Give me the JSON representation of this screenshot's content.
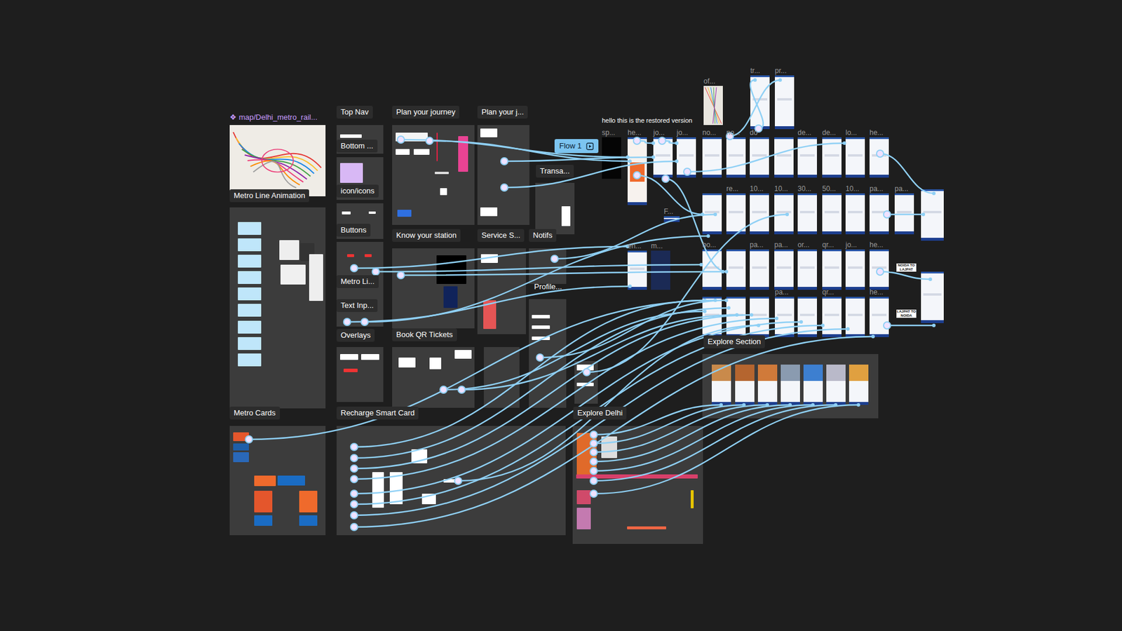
{
  "component": {
    "icon": "❖",
    "label": "map/Delhi_metro_rail..."
  },
  "note": "hello this is the restored version",
  "flow": {
    "label": "Flow 1"
  },
  "sections": [
    {
      "label": "Metro Line Animation",
      "kind": "badge"
    },
    {
      "label": "Metro Cards",
      "kind": "badge"
    },
    {
      "label": "Top Nav",
      "kind": "badge"
    },
    {
      "label": "Bottom ...",
      "kind": "badge"
    },
    {
      "label": "icon/icons",
      "kind": "badge"
    },
    {
      "label": "Buttons",
      "kind": "badge"
    },
    {
      "label": "Metro Li...",
      "kind": "badge"
    },
    {
      "label": "Text Inp...",
      "kind": "badge"
    },
    {
      "label": "Overlays",
      "kind": "badge"
    },
    {
      "label": "Recharge Smart Card",
      "kind": "badge"
    },
    {
      "label": "Plan your journey",
      "kind": "badge"
    },
    {
      "label": "Know your station",
      "kind": "badge"
    },
    {
      "label": "Book QR Tickets",
      "kind": "badge"
    },
    {
      "label": "Plan your j...",
      "kind": "badge"
    },
    {
      "label": "Service S...",
      "kind": "badge"
    },
    {
      "label": "Transa...",
      "kind": "badge"
    },
    {
      "label": "Notifs",
      "kind": "badge"
    },
    {
      "label": "Profile...",
      "kind": "plain"
    },
    {
      "label": "Explore Delhi",
      "kind": "badge"
    },
    {
      "label": "Explore Section",
      "kind": "badge"
    }
  ],
  "frames": [
    {
      "label": "of...",
      "kind": "map"
    },
    {
      "label": "tr...",
      "kind": "screen"
    },
    {
      "label": "pr...",
      "kind": "screen"
    },
    {
      "label": "sp...",
      "kind": "dark"
    },
    {
      "label": "he...",
      "kind": "orange"
    },
    {
      "label": "jo...",
      "kind": "screen"
    },
    {
      "label": "jo...",
      "kind": "screen"
    },
    {
      "label": "no...",
      "kind": "screen"
    },
    {
      "label": "no...",
      "kind": "screen"
    },
    {
      "label": "do",
      "kind": "screen"
    },
    {
      "label": "de...",
      "kind": "screen"
    },
    {
      "label": "de...",
      "kind": "screen"
    },
    {
      "label": "lo...",
      "kind": "screen"
    },
    {
      "label": "he...",
      "kind": "screen"
    },
    {
      "label": "re...",
      "kind": "screen"
    },
    {
      "label": "10...",
      "kind": "screen"
    },
    {
      "label": "10...",
      "kind": "screen"
    },
    {
      "label": "30...",
      "kind": "screen"
    },
    {
      "label": "50...",
      "kind": "screen"
    },
    {
      "label": "10...",
      "kind": "screen"
    },
    {
      "label": "pa...",
      "kind": "screen"
    },
    {
      "label": "pa...",
      "kind": "screen"
    },
    {
      "label": "bo...",
      "kind": "screen"
    },
    {
      "label": "pa...",
      "kind": "screen"
    },
    {
      "label": "pa...",
      "kind": "screen"
    },
    {
      "label": "or...",
      "kind": "screen"
    },
    {
      "label": "qr...",
      "kind": "screen"
    },
    {
      "label": "jo...",
      "kind": "screen"
    },
    {
      "label": "he...",
      "kind": "screen"
    },
    {
      "label": "pa...",
      "kind": "screen"
    },
    {
      "label": "qr...",
      "kind": "screen"
    },
    {
      "label": "he...",
      "kind": "screen"
    },
    {
      "label": "en...",
      "kind": "screen"
    },
    {
      "label": "m...",
      "kind": "navy"
    },
    {
      "label": "F...",
      "kind": "screen"
    }
  ],
  "screen_texts": [
    "NOIDA TO LAJPAT",
    "LAJPAT TO NOIDA"
  ]
}
